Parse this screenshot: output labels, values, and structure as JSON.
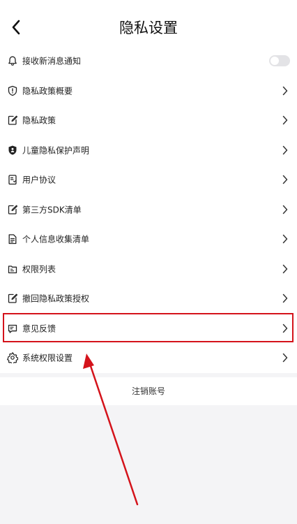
{
  "header": {
    "title": "隐私设置",
    "back_icon": "chevron-left-icon"
  },
  "rows": [
    {
      "label": "接收新消息通知",
      "icon": "bell-icon",
      "control": "toggle",
      "toggle_on": false
    },
    {
      "label": "隐私政策概要",
      "icon": "shield-alert-icon",
      "control": "chevron"
    },
    {
      "label": "隐私政策",
      "icon": "edit-document-icon",
      "control": "chevron"
    },
    {
      "label": "儿童隐私保护声明",
      "icon": "shield-child-icon",
      "control": "chevron"
    },
    {
      "label": "用户协议",
      "icon": "document-icon",
      "control": "chevron"
    },
    {
      "label": "第三方SDK清单",
      "icon": "edit-document-icon",
      "control": "chevron"
    },
    {
      "label": "个人信息收集清单",
      "icon": "list-document-icon",
      "control": "chevron"
    },
    {
      "label": "权限列表",
      "icon": "folder-list-icon",
      "control": "chevron"
    },
    {
      "label": "撤回隐私政策授权",
      "icon": "edit-document-icon",
      "control": "chevron"
    },
    {
      "label": "意见反馈",
      "icon": "chat-bubble-icon",
      "control": "chevron",
      "highlighted": true
    },
    {
      "label": "系统权限设置",
      "icon": "gear-icon",
      "control": "chevron"
    }
  ],
  "logout": {
    "label": "注销账号"
  },
  "annotation": {
    "color": "#d4131b"
  }
}
